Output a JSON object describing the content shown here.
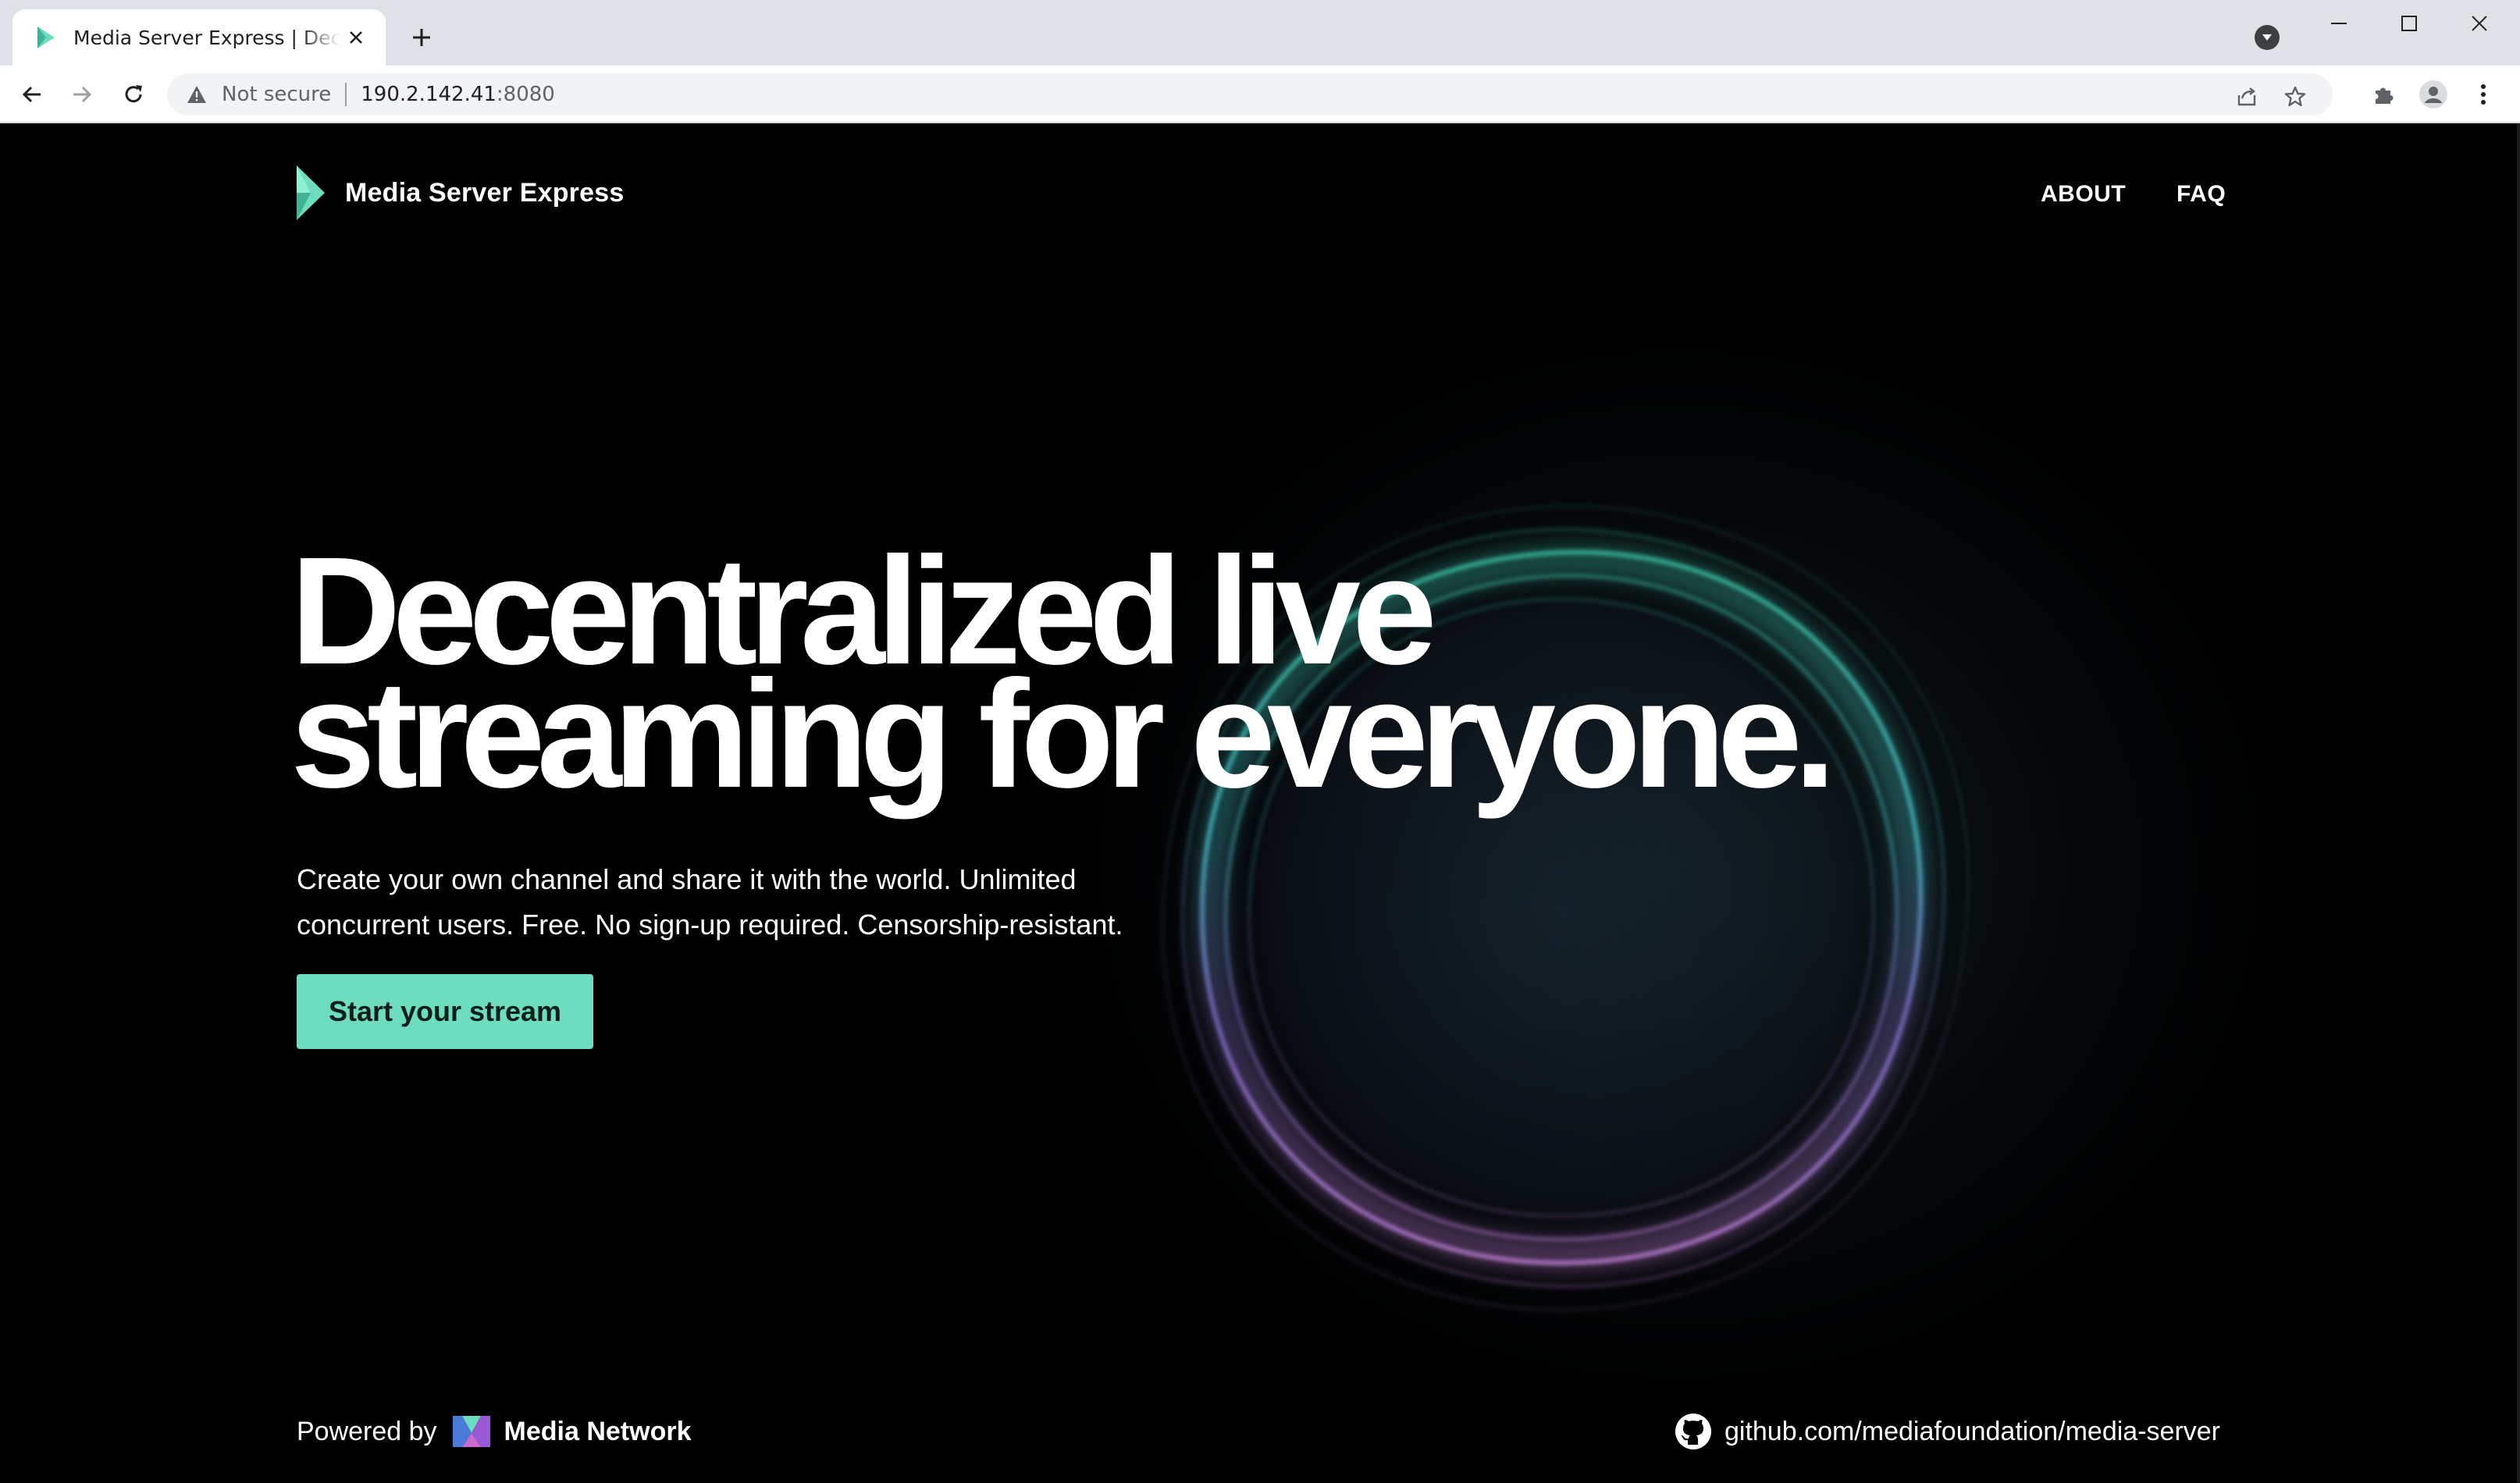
{
  "browser": {
    "tab_title": "Media Server Express | Decentralized live streaming for everyone.",
    "security_label": "Not secure",
    "url_host": "190.2.142.41",
    "url_port": ":8080"
  },
  "site": {
    "brand_name": "Media Server Express",
    "nav": [
      {
        "label": "ABOUT"
      },
      {
        "label": "FAQ"
      }
    ],
    "hero": {
      "title_line1": "Decentralized live",
      "title_line2": "streaming for everyone.",
      "subtitle_line1": "Create your own channel and share it with the world. Unlimited",
      "subtitle_line2": "concurrent users. Free. No sign-up required. Censorship-resistant.",
      "cta_label": "Start your stream"
    },
    "footer": {
      "powered_by": "Powered by",
      "network_name": "Media Network",
      "github_link": "github.com/mediafoundation/media-server"
    }
  },
  "colors": {
    "accent": "#6edcbe",
    "background": "#000000",
    "orb_top": "#3fd0b0",
    "orb_bottom": "#c07ae0"
  },
  "icons": [
    "back-icon",
    "forward-icon",
    "reload-icon",
    "warning-icon",
    "share-icon",
    "star-icon",
    "extensions-icon",
    "profile-icon",
    "menu-icon",
    "github-icon"
  ]
}
